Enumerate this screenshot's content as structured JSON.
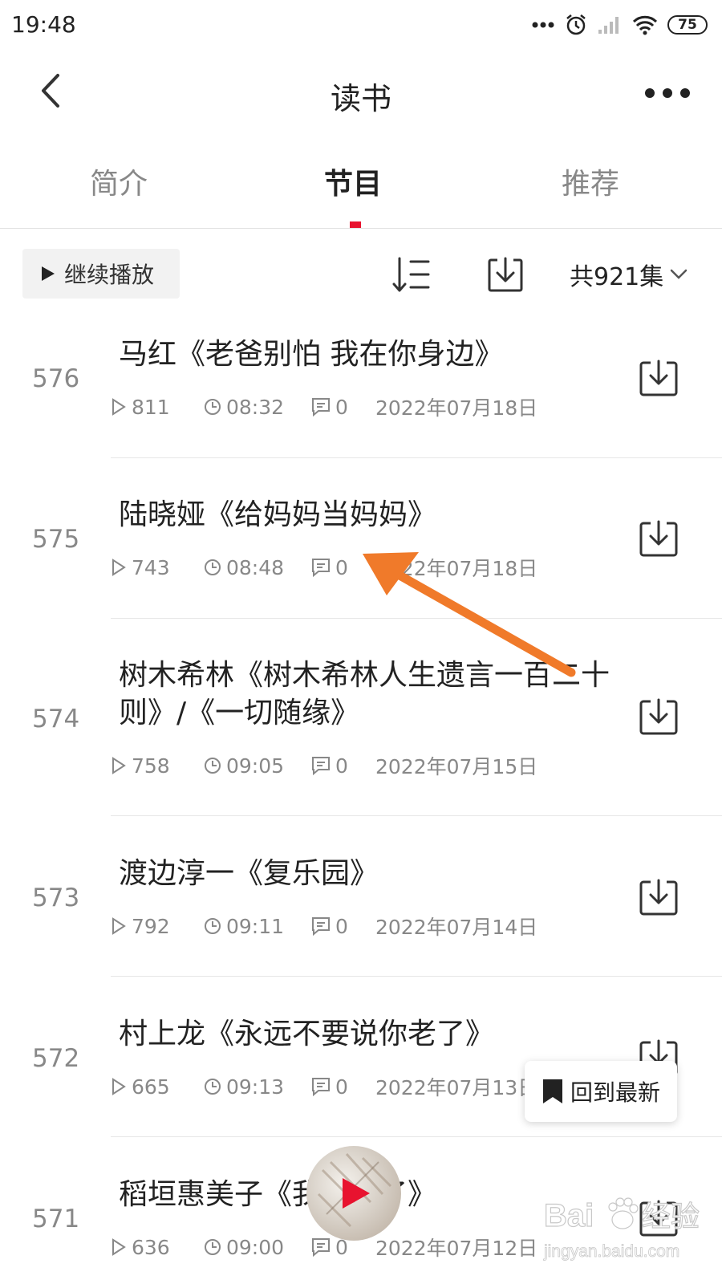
{
  "status_bar": {
    "time": "19:48",
    "battery": "75"
  },
  "header": {
    "title": "读书"
  },
  "tabs": [
    {
      "label": "简介"
    },
    {
      "label": "节目"
    },
    {
      "label": "推荐"
    }
  ],
  "toolbar": {
    "continue_label": "继续播放",
    "episode_count": "共921集"
  },
  "episodes": [
    {
      "num": "576",
      "title": "马红《老爸别怕 我在你身边》",
      "plays": "811",
      "duration": "08:32",
      "comments": "0",
      "date": "2022年07月18日"
    },
    {
      "num": "575",
      "title": "陆晓娅《给妈妈当妈妈》",
      "plays": "743",
      "duration": "08:48",
      "comments": "0",
      "date": "2022年07月18日"
    },
    {
      "num": "574",
      "title": "树木希林《树木希林人生遗言一百二十则》/《一切随缘》",
      "plays": "758",
      "duration": "09:05",
      "comments": "0",
      "date": "2022年07月15日"
    },
    {
      "num": "573",
      "title": "渡边淳一《复乐园》",
      "plays": "792",
      "duration": "09:11",
      "comments": "0",
      "date": "2022年07月14日"
    },
    {
      "num": "572",
      "title": "村上龙《永远不要说你老了》",
      "plays": "665",
      "duration": "09:13",
      "comments": "0",
      "date": "2022年07月13日"
    },
    {
      "num": "571",
      "title": "稻垣惠美子《我辞职了》",
      "plays": "636",
      "duration": "09:00",
      "comments": "0",
      "date": "2022年07月12日"
    }
  ],
  "floating": {
    "back_to_latest": "回到最新"
  },
  "watermark": {
    "brand": "Bai",
    "brand2": "经验",
    "url": "jingyan.baidu.com"
  },
  "colors": {
    "accent": "#e8132f",
    "arrow": "#f07a2a"
  }
}
